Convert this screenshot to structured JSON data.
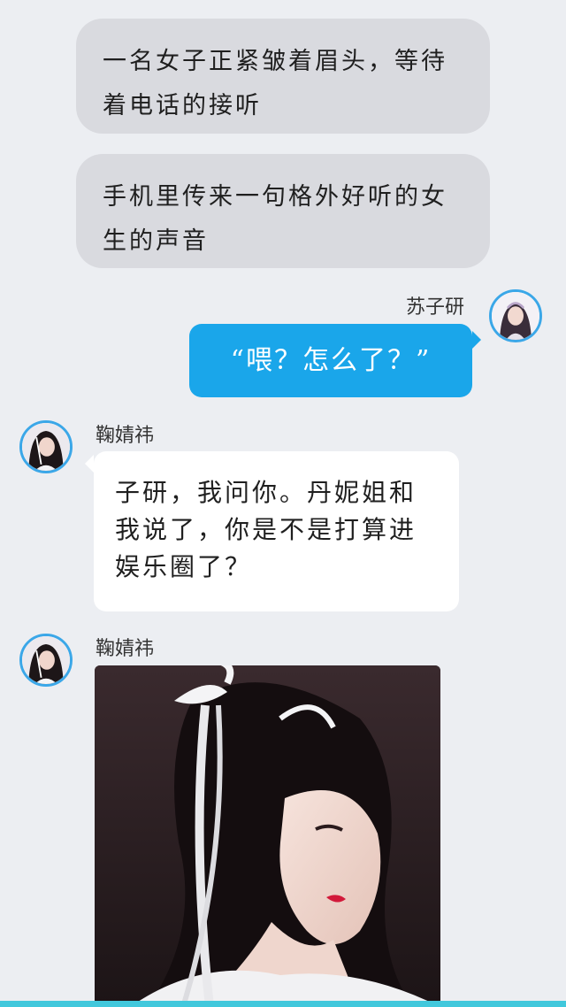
{
  "narrations": [
    "一名女子正紧皱着眉头，等待着电话的接听",
    "手机里传来一句格外好听的女生的声音"
  ],
  "messages": {
    "right": {
      "sender": "苏子研",
      "text": "“喂？怎么了？”",
      "avatar_icon": "avatar-portrait-icon"
    },
    "left_text": {
      "sender": "鞠婧祎",
      "text": "子研，我问你。丹妮姐和我说了，你是不是打算进娱乐圈了？",
      "avatar_icon": "avatar-portrait-icon"
    },
    "left_image": {
      "sender": "鞠婧祎",
      "image_icon": "portrait-photo-icon"
    }
  },
  "colors": {
    "background": "#eceef2",
    "narration_bubble": "#d9dadf",
    "right_bubble": "#1aa6ea",
    "left_bubble": "#ffffff",
    "avatar_ring": "#3ba7e8",
    "bottom_bar": "#41c8dc"
  }
}
